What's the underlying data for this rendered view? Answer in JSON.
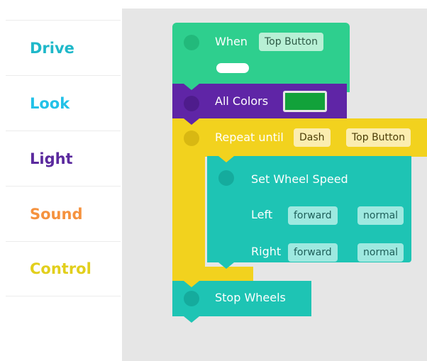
{
  "sidebar": {
    "categories": [
      {
        "label": "Drive",
        "color": "#1fb8c9"
      },
      {
        "label": "Look",
        "color": "#22c1e8"
      },
      {
        "label": "Light",
        "color": "#5b2a9e"
      },
      {
        "label": "Sound",
        "color": "#f5923e"
      },
      {
        "label": "Control",
        "color": "#e2cf1c"
      }
    ]
  },
  "blocks": {
    "when": {
      "label": "When",
      "trigger": "Top Button"
    },
    "all_colors": {
      "label": "All Colors",
      "swatch_color": "#12a23a"
    },
    "repeat": {
      "label": "Repeat until",
      "robot": "Dash",
      "condition": "Top Button"
    },
    "set_wheel_speed": {
      "label": "Set Wheel Speed",
      "left_label": "Left",
      "left_direction": "forward",
      "left_speed": "normal",
      "right_label": "Right",
      "right_direction": "forward",
      "right_speed": "normal"
    },
    "stop_wheels": {
      "label": "Stop Wheels"
    }
  }
}
